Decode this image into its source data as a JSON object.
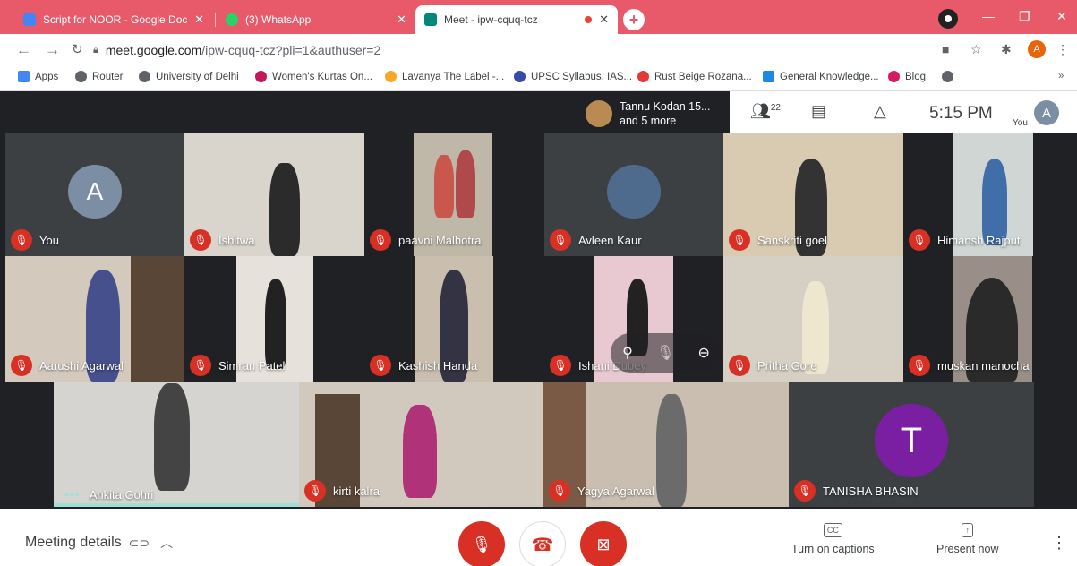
{
  "browser": {
    "tabs": [
      {
        "title": "Script for NOOR - Google Docs",
        "favicon_color": "#4285f4",
        "active": false
      },
      {
        "title": "(3) WhatsApp",
        "favicon_color": "#25d366",
        "active": false
      },
      {
        "title": "Meet - ipw-cquq-tcz",
        "favicon_color": "#00897b",
        "active": true,
        "recording_dot_color": "#ea4335"
      }
    ],
    "accent_color": "#e85a6a",
    "url_domain": "meet.google.com",
    "url_path": "/ipw-cquq-tcz?pli=1&authuser=2",
    "profile_initial": "A",
    "bookmarks": [
      {
        "label": "Apps",
        "icon": "apps-grid-icon",
        "color": "#4285f4"
      },
      {
        "label": "Router",
        "icon": "globe-icon",
        "color": "#5f6368"
      },
      {
        "label": "University of Delhi",
        "icon": "globe-icon",
        "color": "#5f6368"
      },
      {
        "label": "Women's Kurtas On...",
        "icon": "shop-icon",
        "color": "#c2185b"
      },
      {
        "label": "Lavanya The Label -...",
        "icon": "shop-icon",
        "color": "#f9a825"
      },
      {
        "label": "UPSC Syllabus, IAS...",
        "icon": "cap-icon",
        "color": "#3949ab"
      },
      {
        "label": "Rust Beige Rozana...",
        "icon": "shop-icon",
        "color": "#e53935"
      },
      {
        "label": "General Knowledge...",
        "icon": "book-icon",
        "color": "#1e88e5"
      },
      {
        "label": "Blog",
        "icon": "blog-icon",
        "color": "#d81b60"
      },
      {
        "label": "",
        "icon": "globe-icon",
        "color": "#5f6368"
      }
    ],
    "bookmarks_overflow": "»"
  },
  "meet": {
    "presenter_text_line1": "Tannu Kodan 15...",
    "presenter_text_line2": "and 5 more",
    "participants_count": "22",
    "time": "5:15 PM",
    "you_label": "You",
    "you_initial": "A",
    "tiles": [
      {
        "name": "You",
        "avatar": "A",
        "avatar_color": "#7c8ea3",
        "bg": "#3c4043"
      },
      {
        "name": "Ishitwa",
        "bg": "#d9d4cc",
        "figure": "#2b2b2b"
      },
      {
        "name": "paavni Malhotra",
        "bg": "#bfb7a8",
        "figure": "#c9574b"
      },
      {
        "name": "Avleen Kaur",
        "bg": "#3c4043",
        "avatar_photo": true
      },
      {
        "name": "Sanskriti goel",
        "bg": "#d8cbb2",
        "figure": "#333"
      },
      {
        "name": "Himansh Rajput",
        "bg": "#cfd6d3",
        "figure": "#3f6ea8"
      },
      {
        "name": "Aarushi Agarwal",
        "bg": "#d3cabd",
        "figure": "#45508c"
      },
      {
        "name": "Simran Patel",
        "bg": "#e6e1da",
        "figure": "#222"
      },
      {
        "name": "Kashish Handa",
        "bg": "#cabfae",
        "figure": "#334"
      },
      {
        "name": "Ishani Dubey",
        "bg": "#e9c9d1",
        "figure": "#222"
      },
      {
        "name": "Pritha Gore",
        "bg": "#d6d0c4",
        "figure": "#efe6cf"
      },
      {
        "name": "muskan manocha",
        "bg": "#9a8f88",
        "figure": "#2a2a2a"
      },
      {
        "name": "Ankita Gohri",
        "bg": "#d6d4d0",
        "figure": "#444",
        "speaking": true
      },
      {
        "name": "kirti kalra",
        "bg": "#d1c8be",
        "figure": "#b0337a"
      },
      {
        "name": "Yagya Agarwal",
        "bg": "#c9beb0",
        "figure": "#6b6b6b"
      },
      {
        "name": "TANISHA BHASIN",
        "avatar": "T",
        "avatar_color": "#7b1fa2",
        "bg": "#3c4043"
      }
    ]
  },
  "bottombar": {
    "meeting_details": "Meeting details",
    "captions_label": "Turn on captions",
    "captions_icon": "CC",
    "present_label": "Present now",
    "mic_color": "#d93025",
    "cam_color": "#d93025",
    "leave_color": "#d93025"
  }
}
